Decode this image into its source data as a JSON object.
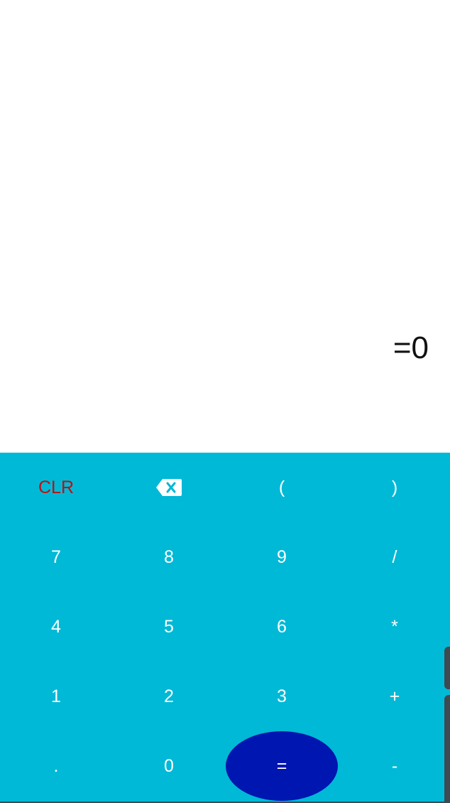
{
  "display": {
    "result": "=0"
  },
  "keypad": {
    "row1": {
      "clear": "CLR",
      "backspace_icon": "backspace-icon",
      "open_paren": "(",
      "close_paren": ")"
    },
    "row2": {
      "seven": "7",
      "eight": "8",
      "nine": "9",
      "divide": "/"
    },
    "row3": {
      "four": "4",
      "five": "5",
      "six": "6",
      "multiply": "*"
    },
    "row4": {
      "one": "1",
      "two": "2",
      "three": "3",
      "plus": "+"
    },
    "row5": {
      "dot": ".",
      "zero": "0",
      "equals": "=",
      "minus": "-"
    }
  },
  "colors": {
    "keypad_background": "#00b9d6",
    "equals_button": "#0016b0",
    "clear_text": "#c01010",
    "key_text": "#ffffff",
    "result_text": "#111111"
  }
}
